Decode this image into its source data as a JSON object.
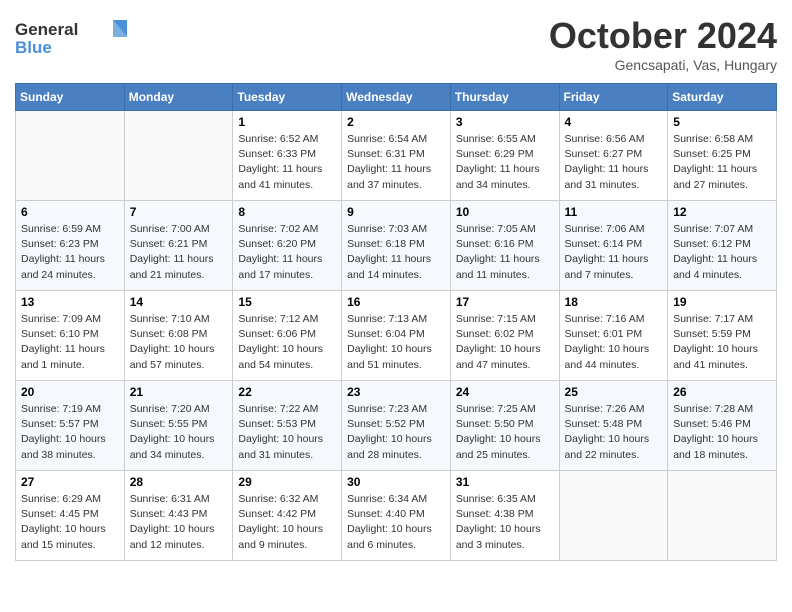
{
  "header": {
    "logo_line1": "General",
    "logo_line2": "Blue",
    "month_title": "October 2024",
    "subtitle": "Gencsapati, Vas, Hungary"
  },
  "days_of_week": [
    "Sunday",
    "Monday",
    "Tuesday",
    "Wednesday",
    "Thursday",
    "Friday",
    "Saturday"
  ],
  "weeks": [
    [
      {
        "day": "",
        "sunrise": "",
        "sunset": "",
        "daylight": ""
      },
      {
        "day": "",
        "sunrise": "",
        "sunset": "",
        "daylight": ""
      },
      {
        "day": "1",
        "sunrise": "Sunrise: 6:52 AM",
        "sunset": "Sunset: 6:33 PM",
        "daylight": "Daylight: 11 hours and 41 minutes."
      },
      {
        "day": "2",
        "sunrise": "Sunrise: 6:54 AM",
        "sunset": "Sunset: 6:31 PM",
        "daylight": "Daylight: 11 hours and 37 minutes."
      },
      {
        "day": "3",
        "sunrise": "Sunrise: 6:55 AM",
        "sunset": "Sunset: 6:29 PM",
        "daylight": "Daylight: 11 hours and 34 minutes."
      },
      {
        "day": "4",
        "sunrise": "Sunrise: 6:56 AM",
        "sunset": "Sunset: 6:27 PM",
        "daylight": "Daylight: 11 hours and 31 minutes."
      },
      {
        "day": "5",
        "sunrise": "Sunrise: 6:58 AM",
        "sunset": "Sunset: 6:25 PM",
        "daylight": "Daylight: 11 hours and 27 minutes."
      }
    ],
    [
      {
        "day": "6",
        "sunrise": "Sunrise: 6:59 AM",
        "sunset": "Sunset: 6:23 PM",
        "daylight": "Daylight: 11 hours and 24 minutes."
      },
      {
        "day": "7",
        "sunrise": "Sunrise: 7:00 AM",
        "sunset": "Sunset: 6:21 PM",
        "daylight": "Daylight: 11 hours and 21 minutes."
      },
      {
        "day": "8",
        "sunrise": "Sunrise: 7:02 AM",
        "sunset": "Sunset: 6:20 PM",
        "daylight": "Daylight: 11 hours and 17 minutes."
      },
      {
        "day": "9",
        "sunrise": "Sunrise: 7:03 AM",
        "sunset": "Sunset: 6:18 PM",
        "daylight": "Daylight: 11 hours and 14 minutes."
      },
      {
        "day": "10",
        "sunrise": "Sunrise: 7:05 AM",
        "sunset": "Sunset: 6:16 PM",
        "daylight": "Daylight: 11 hours and 11 minutes."
      },
      {
        "day": "11",
        "sunrise": "Sunrise: 7:06 AM",
        "sunset": "Sunset: 6:14 PM",
        "daylight": "Daylight: 11 hours and 7 minutes."
      },
      {
        "day": "12",
        "sunrise": "Sunrise: 7:07 AM",
        "sunset": "Sunset: 6:12 PM",
        "daylight": "Daylight: 11 hours and 4 minutes."
      }
    ],
    [
      {
        "day": "13",
        "sunrise": "Sunrise: 7:09 AM",
        "sunset": "Sunset: 6:10 PM",
        "daylight": "Daylight: 11 hours and 1 minute."
      },
      {
        "day": "14",
        "sunrise": "Sunrise: 7:10 AM",
        "sunset": "Sunset: 6:08 PM",
        "daylight": "Daylight: 10 hours and 57 minutes."
      },
      {
        "day": "15",
        "sunrise": "Sunrise: 7:12 AM",
        "sunset": "Sunset: 6:06 PM",
        "daylight": "Daylight: 10 hours and 54 minutes."
      },
      {
        "day": "16",
        "sunrise": "Sunrise: 7:13 AM",
        "sunset": "Sunset: 6:04 PM",
        "daylight": "Daylight: 10 hours and 51 minutes."
      },
      {
        "day": "17",
        "sunrise": "Sunrise: 7:15 AM",
        "sunset": "Sunset: 6:02 PM",
        "daylight": "Daylight: 10 hours and 47 minutes."
      },
      {
        "day": "18",
        "sunrise": "Sunrise: 7:16 AM",
        "sunset": "Sunset: 6:01 PM",
        "daylight": "Daylight: 10 hours and 44 minutes."
      },
      {
        "day": "19",
        "sunrise": "Sunrise: 7:17 AM",
        "sunset": "Sunset: 5:59 PM",
        "daylight": "Daylight: 10 hours and 41 minutes."
      }
    ],
    [
      {
        "day": "20",
        "sunrise": "Sunrise: 7:19 AM",
        "sunset": "Sunset: 5:57 PM",
        "daylight": "Daylight: 10 hours and 38 minutes."
      },
      {
        "day": "21",
        "sunrise": "Sunrise: 7:20 AM",
        "sunset": "Sunset: 5:55 PM",
        "daylight": "Daylight: 10 hours and 34 minutes."
      },
      {
        "day": "22",
        "sunrise": "Sunrise: 7:22 AM",
        "sunset": "Sunset: 5:53 PM",
        "daylight": "Daylight: 10 hours and 31 minutes."
      },
      {
        "day": "23",
        "sunrise": "Sunrise: 7:23 AM",
        "sunset": "Sunset: 5:52 PM",
        "daylight": "Daylight: 10 hours and 28 minutes."
      },
      {
        "day": "24",
        "sunrise": "Sunrise: 7:25 AM",
        "sunset": "Sunset: 5:50 PM",
        "daylight": "Daylight: 10 hours and 25 minutes."
      },
      {
        "day": "25",
        "sunrise": "Sunrise: 7:26 AM",
        "sunset": "Sunset: 5:48 PM",
        "daylight": "Daylight: 10 hours and 22 minutes."
      },
      {
        "day": "26",
        "sunrise": "Sunrise: 7:28 AM",
        "sunset": "Sunset: 5:46 PM",
        "daylight": "Daylight: 10 hours and 18 minutes."
      }
    ],
    [
      {
        "day": "27",
        "sunrise": "Sunrise: 6:29 AM",
        "sunset": "Sunset: 4:45 PM",
        "daylight": "Daylight: 10 hours and 15 minutes."
      },
      {
        "day": "28",
        "sunrise": "Sunrise: 6:31 AM",
        "sunset": "Sunset: 4:43 PM",
        "daylight": "Daylight: 10 hours and 12 minutes."
      },
      {
        "day": "29",
        "sunrise": "Sunrise: 6:32 AM",
        "sunset": "Sunset: 4:42 PM",
        "daylight": "Daylight: 10 hours and 9 minutes."
      },
      {
        "day": "30",
        "sunrise": "Sunrise: 6:34 AM",
        "sunset": "Sunset: 4:40 PM",
        "daylight": "Daylight: 10 hours and 6 minutes."
      },
      {
        "day": "31",
        "sunrise": "Sunrise: 6:35 AM",
        "sunset": "Sunset: 4:38 PM",
        "daylight": "Daylight: 10 hours and 3 minutes."
      },
      {
        "day": "",
        "sunrise": "",
        "sunset": "",
        "daylight": ""
      },
      {
        "day": "",
        "sunrise": "",
        "sunset": "",
        "daylight": ""
      }
    ]
  ]
}
